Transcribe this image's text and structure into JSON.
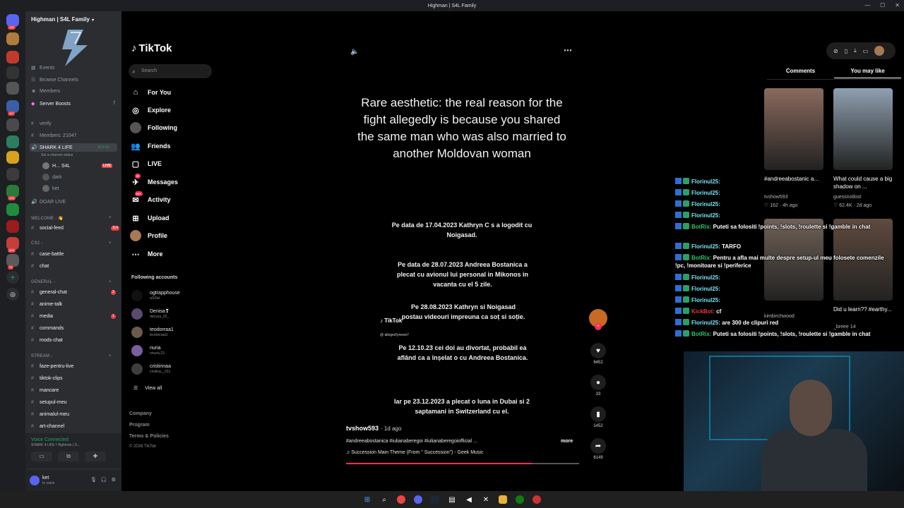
{
  "window": {
    "title": "Highman | S4L Family"
  },
  "discord": {
    "rail_badges": [
      "130",
      "117",
      "404",
      "128",
      "509",
      "71"
    ],
    "server_name": "Highman | S4L Family",
    "top_items": [
      {
        "label": "Events"
      },
      {
        "label": "Browse Channels"
      },
      {
        "label": "Members"
      },
      {
        "label": "Server Boosts",
        "count": "7"
      }
    ],
    "channels_top": [
      {
        "label": "verify"
      },
      {
        "label": "Members: 21047"
      }
    ],
    "shark": {
      "label": "SHARK 4 LIFE",
      "time": "4:51:53",
      "status": "Set a channel status"
    },
    "voice_users": [
      {
        "label": "H... S4L",
        "live": "LIVE"
      },
      {
        "label": "dark"
      },
      {
        "label": "ket"
      }
    ],
    "doar_live": "DOAR LIVE",
    "welcome_cat": "WELCOME - 👋",
    "social_feed": {
      "label": "social-feed",
      "count": "114"
    },
    "cs2_cat": "CS2 -",
    "cs2_items": [
      {
        "label": "case-battle"
      },
      {
        "label": "chat"
      }
    ],
    "general_cat": "GENERAL -",
    "general_items": [
      {
        "label": "general-chat",
        "count": "2"
      },
      {
        "label": "anime-talk"
      },
      {
        "label": "media",
        "count": "1"
      },
      {
        "label": "commands"
      },
      {
        "label": "mods-chat"
      }
    ],
    "stream_cat": "STREAM -",
    "stream_items": [
      {
        "label": "faze-pentru-live"
      },
      {
        "label": "tiktok-clips"
      },
      {
        "label": "mancare"
      },
      {
        "label": "setupul-meu"
      },
      {
        "label": "animalul-meu"
      },
      {
        "label": "art-channel"
      }
    ],
    "voice_connected": "Voice Connected",
    "voice_sub": "SHARK 4 LIFE / Highman | S...",
    "user": {
      "name": "ket",
      "status": "In voice"
    }
  },
  "tiktok": {
    "brand": "TikTok",
    "search_placeholder": "Search",
    "nav": [
      {
        "label": "For You",
        "icon": "home-icon"
      },
      {
        "label": "Explore",
        "icon": "compass-icon"
      },
      {
        "label": "Following",
        "icon": "following-icon"
      },
      {
        "label": "Friends",
        "icon": "friends-icon"
      },
      {
        "label": "LIVE",
        "icon": "live-icon"
      },
      {
        "label": "Messages",
        "icon": "message-icon",
        "badge": "57"
      },
      {
        "label": "Activity",
        "icon": "activity-icon",
        "badge": "99+"
      },
      {
        "label": "Upload",
        "icon": "upload-icon"
      },
      {
        "label": "Profile",
        "icon": "profile-icon"
      },
      {
        "label": "More",
        "icon": "more-icon"
      }
    ],
    "following_title": "Following accounts",
    "following": [
      {
        "name": "ogtrapphouse",
        "handle": "al10lel"
      },
      {
        "name": "Denisa❣",
        "handle": "denysa_02_"
      },
      {
        "name": "teodorraa1",
        "handle": "teodorraa1t"
      },
      {
        "name": "nuria",
        "handle": "nnuria.23"
      },
      {
        "name": "cristinnaa",
        "handle": "cristina__011"
      }
    ],
    "view_all": "View all",
    "footer": [
      "Company",
      "Program",
      "Terms & Policies"
    ],
    "copyright": "© 2026 TikTok",
    "video": {
      "title": "Rare aesthetic: the real reason for the fight allegedly is because you shared the same man who was also married to another Moldovan woman",
      "paragraphs": [
        "Pe data de 17.04.2023 Kathryn C s a logodit cu Noigasad.",
        "Pe data de 28.07.2023 Andreea Bostanica a plecat cu avionul lui personal in Mikonos in vacanta cu el 5 zile.",
        "Pe 28.08.2023 Kathryn si Noigasad postau videouri impreuna ca soț si soție.",
        "Pe 12.10.23 cei doi au divortat, probabil ea aflând ca a înșelat o cu Andreea Bostanica.",
        "Iar pe 23.12.2023 a plecat o luna in Dubai si 2 saptamani in Switzerland cu el."
      ],
      "watermark": "TikTok",
      "watermark_handle": "@ alleged!ynews7",
      "author": "tvshow593",
      "posted": "· 1d ago",
      "tags": "#andreeabostanica #iulianaberegoi #iulianaberegoiofficial ...",
      "more": "more",
      "music": "Succession Main Theme (From \" Succession\") - Geek Music",
      "progress": 0.8
    },
    "actions": [
      {
        "icon": "heart-icon",
        "count": "6452"
      },
      {
        "icon": "comment-icon",
        "count": "33"
      },
      {
        "icon": "bookmark-icon",
        "count": "1452"
      },
      {
        "icon": "share-icon",
        "count": "6149"
      }
    ],
    "right_tabs": [
      "Comments",
      "You may like"
    ],
    "suggestions": [
      {
        "caption": "#andreeabostanic a...",
        "author": "tvshow593",
        "stats": "♡ 162 · 4h ago",
        "color": "#8a6a5e"
      },
      {
        "caption": "What could cause a big shadow on ...",
        "author": "guessnotlost",
        "stats": "♡ 62.4K · 2d ago",
        "color": "#8fa0b0"
      },
      {
        "caption": "",
        "author": "kimbirchwood",
        "stats": "",
        "color": "#6f6156"
      },
      {
        "caption": "Did u learn?? #earthy...",
        "author": "_breee 14",
        "stats": "",
        "color": "#5f4a3e"
      }
    ]
  },
  "chat": [
    {
      "name": "Florinul25:",
      "msg": "",
      "color": "n1"
    },
    {
      "name": "Florinul25:",
      "msg": "",
      "color": "n1"
    },
    {
      "name": "Florinul25:",
      "msg": "",
      "color": "n1"
    },
    {
      "name": "Florinul25:",
      "msg": "",
      "color": "n1"
    },
    {
      "name": "BotRix:",
      "msg": "Puteti sa folositi !points, !slots, !roulette si !gamble in chat",
      "color": "n2"
    },
    {
      "name": "Florinul25:",
      "msg": "TARFO",
      "color": "n1"
    },
    {
      "name": "BotRix:",
      "msg": "Pentru a afla mai multe despre setup-ul meu folosete comenzile !pc, !monitoare si !periferice",
      "color": "n2"
    },
    {
      "name": "Florinul25:",
      "msg": "",
      "color": "n1"
    },
    {
      "name": "Florinul25:",
      "msg": "",
      "color": "n1"
    },
    {
      "name": "Florinul25:",
      "msg": "",
      "color": "n1"
    },
    {
      "name": "KickBot:",
      "msg": "cf",
      "color": "n3"
    },
    {
      "name": "Florinul25:",
      "msg": "are 300 de clipuri red",
      "color": "n1"
    },
    {
      "name": "BotRix:",
      "msg": "Puteti sa folositi !points, !slots, !roulette si !gamble in chat",
      "color": "n2"
    }
  ]
}
